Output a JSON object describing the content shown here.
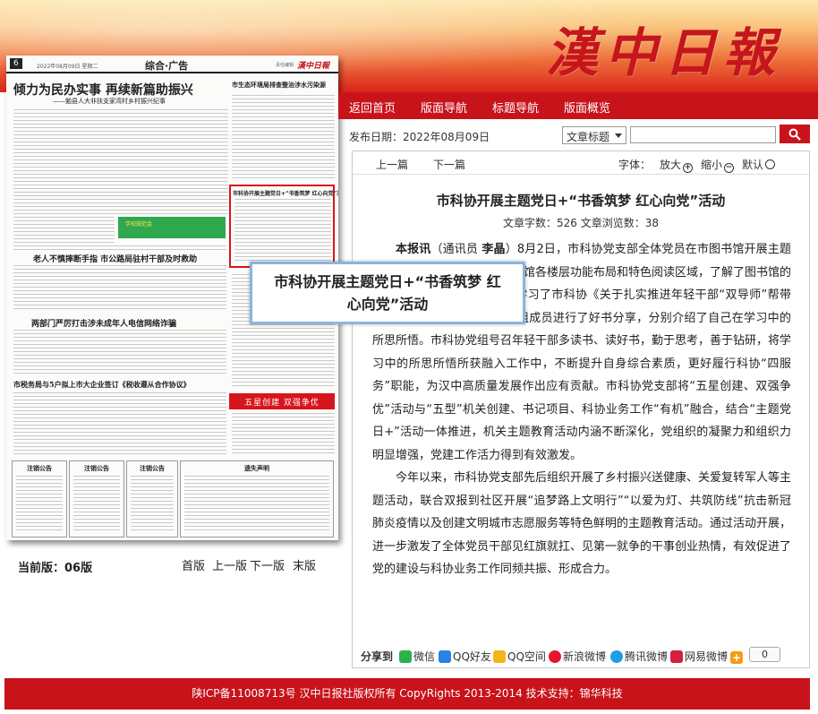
{
  "header": {
    "logo_text": "漢中日報"
  },
  "nav": [
    "返回首页",
    "版面导航",
    "标题导航",
    "版面概览"
  ],
  "thumbnail": {
    "page_number": "6",
    "date": "2022年08月09日  星期二",
    "section": "综合·广告",
    "editor": "责任编辑",
    "logo": "漢中日報",
    "headline_main": "倾力为民办实事  再续新篇助振兴",
    "headline_sub": "——勉县人大非扶支家湾村乡村振兴纪事",
    "headline_right": "市生态环境局排查整治涉水污染源",
    "headline_box": "市科协开展主题党日+“书香筑梦 红心向党”活动",
    "headline_2": "老人不慎摔断手指  市公路局驻村干部及时救助",
    "headline_3": "两部门严厉打击涉未成年人电信网络诈骗",
    "headline_4": "市税务局与5户拟上市大企业签订《税收遵从合作协议》",
    "ad_text_1": "学校规范金",
    "ad_text_2": "五星创建  双强争优",
    "notices": [
      "注销公告",
      "注销公告",
      "注销公告",
      "遗失声明",
      "注销公告"
    ]
  },
  "popup": {
    "line1": "市科协开展主题党日+“书香筑梦 红",
    "line2": "心向党”活动"
  },
  "page_nav": {
    "current_label": "当前版：06版",
    "first": "首版",
    "prev": "上一版",
    "next": "下一版",
    "last": "末版"
  },
  "toolbar": {
    "date_label": "发布日期：2022年08月09日",
    "select_value": "文章标题",
    "search_placeholder": ""
  },
  "article": {
    "prev": "上一篇",
    "next": "下一篇",
    "font_label": "字体：",
    "zoom_in": "放大",
    "zoom_out": "缩小",
    "default": "默认",
    "title": "市科协开展主题党日+“书香筑梦 红心向党”活动",
    "stats": "文章字数：526   文章浏览数：38",
    "p1_lead": "本报讯",
    "p1_a": "（通讯员 ",
    "p1_name": "李晶",
    "p1_b": "）8月2日，市科协党支部全体党员在市图书馆开展主题党日活动。党员们参观了图书馆各楼层功能布局和特色阅读区域，了解了图书馆的建设情况和服务成效，集中学习了市科协《关于扎实推进年轻干部“双导师”帮带制度》，4名青年理论学习小组成员进行了好书分享，分别介绍了自己在学习中的所思所悟。市科协党组号召年轻干部多读书、读好书，勤于思考，善于钻研，将学习中的所思所悟所获融入工作中，不断提升自身综合素质，更好履行科协“四服务”职能，为汉中高质量发展作出应有贡献。市科协党支部将“五星创建、双强争优”活动与“五型”机关创建、书记项目、科协业务工作“有机”融合，结合“主题党日+”活动一体推进，机关主题教育活动内涵不断深化，党组织的凝聚力和组织力明显增强，党建工作活力得到有效激发。",
    "p2": "今年以来，市科协党支部先后组织开展了乡村振兴送健康、关爱复转军人等主题活动，联合双报到社区开展“追梦路上文明行”“以爱为灯、共筑防线”抗击新冠肺炎疫情以及创建文明城市志愿服务等特色鲜明的主题教育活动。通过活动开展，进一步激发了全体党员干部见红旗就扛、见第一就争的干事创业热情，有效促进了党的建设与科协业务工作同频共振、形成合力。"
  },
  "share": {
    "label": "分享到",
    "items": [
      {
        "label": "微信",
        "color": "#2bb24c"
      },
      {
        "label": "QQ好友",
        "color": "#2a82e4"
      },
      {
        "label": "QQ空间",
        "color": "#f2b619"
      },
      {
        "label": "新浪微博",
        "color": "#e6162d"
      },
      {
        "label": "腾讯微博",
        "color": "#1d9de6"
      },
      {
        "label": "网易微博",
        "color": "#d6203a"
      }
    ],
    "count": "0"
  },
  "footer": {
    "text": "陕ICP备11008713号 汉中日报社版权所有 CopyRights 2013-2014    技术支持：锦华科技"
  }
}
